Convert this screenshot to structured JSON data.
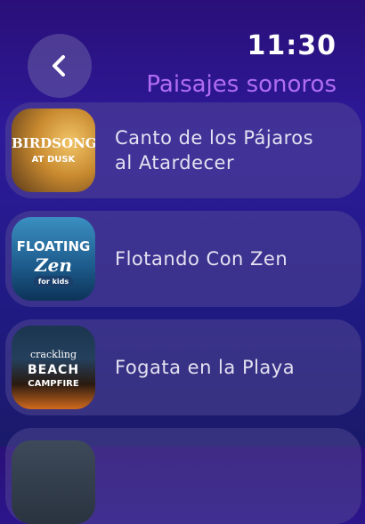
{
  "header": {
    "time": "11:30",
    "title": "Paisajes sonoros",
    "back_icon": "chevron-left-icon"
  },
  "items": [
    {
      "label_line1": "Canto de los Pájaros",
      "label_line2": "al Atardecer",
      "thumb_line1": "BIRDSONG",
      "thumb_line2": "AT DUSK"
    },
    {
      "label": "Flotando Con Zen",
      "thumb_line1": "FLOATING",
      "thumb_line2": "Zen",
      "thumb_line3": "for kids"
    },
    {
      "label": "Fogata en la Playa",
      "thumb_line1": "crackling",
      "thumb_line2": "BEACH",
      "thumb_line3": "CAMPFIRE"
    }
  ]
}
